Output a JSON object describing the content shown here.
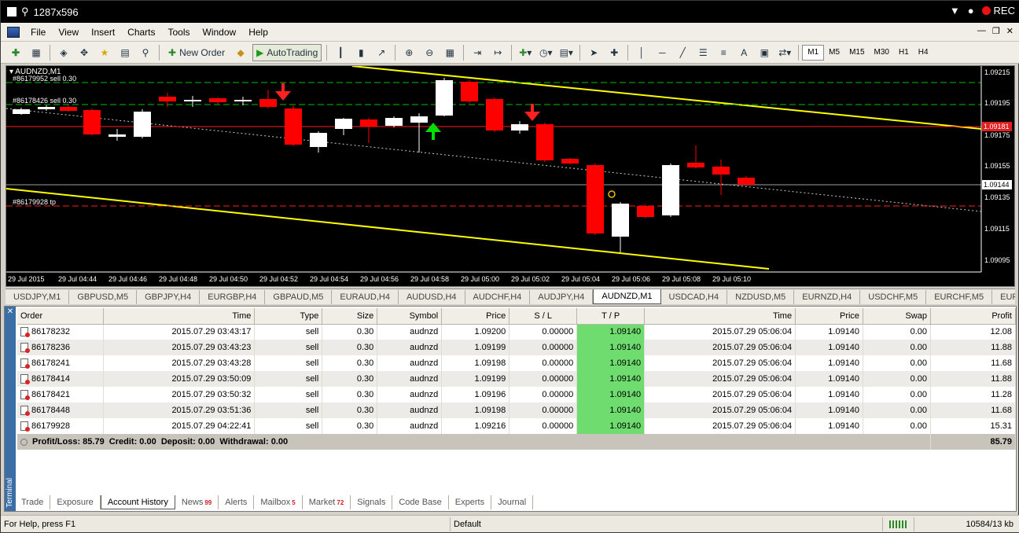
{
  "recorder": {
    "title": "1287x596",
    "rec_label": "REC"
  },
  "menu": [
    "File",
    "View",
    "Insert",
    "Charts",
    "Tools",
    "Window",
    "Help"
  ],
  "toolbar": {
    "new_order": "New Order",
    "autotrading": "AutoTrading",
    "timeframes": [
      "M1",
      "M5",
      "M15",
      "M30",
      "H1",
      "H4"
    ],
    "active_tf": "M1"
  },
  "chart": {
    "symbol_label": "AUDNZD,M1",
    "order_labels": [
      {
        "text": "#86179952 sell 0.30"
      },
      {
        "text": "#86178426 sell 0.30"
      },
      {
        "text": "#86179928 tp"
      }
    ],
    "price_labels": [
      "1.09215",
      "1.09195",
      "1.09175",
      "1.09155",
      "1.09135",
      "1.09115",
      "1.09095"
    ],
    "highlight_prices": {
      "bid": "1.09181",
      "tp": "1.09144"
    },
    "time_labels": [
      "29 Jul 2015",
      "29 Jul 04:44",
      "29 Jul 04:46",
      "29 Jul 04:48",
      "29 Jul 04:50",
      "29 Jul 04:52",
      "29 Jul 04:54",
      "29 Jul 04:56",
      "29 Jul 04:58",
      "29 Jul 05:00",
      "29 Jul 05:02",
      "29 Jul 05:04",
      "29 Jul 05:06",
      "29 Jul 05:08",
      "29 Jul 05:10"
    ]
  },
  "symbol_tabs": [
    "USDJPY,M1",
    "GBPUSD,M5",
    "GBPJPY,H4",
    "EURGBP,H4",
    "GBPAUD,M5",
    "EURAUD,H4",
    "AUDUSD,H4",
    "AUDCHF,H4",
    "AUDJPY,H4",
    "AUDNZD,M1",
    "USDCAD,H4",
    "NZDUSD,M5",
    "EURNZD,H4",
    "USDCHF,M5",
    "EURCHF,M5",
    "EURJPY,H"
  ],
  "active_symbol_tab": "AUDNZD,M1",
  "terminal": {
    "side_label": "Terminal",
    "columns": [
      "Order",
      "Time",
      "Type",
      "Size",
      "Symbol",
      "Price",
      "S / L",
      "T / P",
      "Time",
      "Price",
      "Swap",
      "Profit"
    ],
    "rows": [
      [
        "86178232",
        "2015.07.29 03:43:17",
        "sell",
        "0.30",
        "audnzd",
        "1.09200",
        "0.00000",
        "1.09140",
        "2015.07.29 05:06:04",
        "1.09140",
        "0.00",
        "12.08"
      ],
      [
        "86178236",
        "2015.07.29 03:43:23",
        "sell",
        "0.30",
        "audnzd",
        "1.09199",
        "0.00000",
        "1.09140",
        "2015.07.29 05:06:04",
        "1.09140",
        "0.00",
        "11.88"
      ],
      [
        "86178241",
        "2015.07.29 03:43:28",
        "sell",
        "0.30",
        "audnzd",
        "1.09198",
        "0.00000",
        "1.09140",
        "2015.07.29 05:06:04",
        "1.09140",
        "0.00",
        "11.68"
      ],
      [
        "86178414",
        "2015.07.29 03:50:09",
        "sell",
        "0.30",
        "audnzd",
        "1.09199",
        "0.00000",
        "1.09140",
        "2015.07.29 05:06:04",
        "1.09140",
        "0.00",
        "11.88"
      ],
      [
        "86178421",
        "2015.07.29 03:50:32",
        "sell",
        "0.30",
        "audnzd",
        "1.09196",
        "0.00000",
        "1.09140",
        "2015.07.29 05:06:04",
        "1.09140",
        "0.00",
        "11.28"
      ],
      [
        "86178448",
        "2015.07.29 03:51:36",
        "sell",
        "0.30",
        "audnzd",
        "1.09198",
        "0.00000",
        "1.09140",
        "2015.07.29 05:06:04",
        "1.09140",
        "0.00",
        "11.68"
      ],
      [
        "86179928",
        "2015.07.29 04:22:41",
        "sell",
        "0.30",
        "audnzd",
        "1.09216",
        "0.00000",
        "1.09140",
        "2015.07.29 05:06:04",
        "1.09140",
        "0.00",
        "15.31"
      ]
    ],
    "summary": "Profit/Loss: 85.79  Credit: 0.00  Deposit: 0.00  Withdrawal: 0.00",
    "summary_total": "85.79"
  },
  "bottom_tabs": [
    {
      "label": "Trade"
    },
    {
      "label": "Exposure"
    },
    {
      "label": "Account History",
      "active": true
    },
    {
      "label": "News",
      "badge": "99"
    },
    {
      "label": "Alerts"
    },
    {
      "label": "Mailbox",
      "badge": "5"
    },
    {
      "label": "Market",
      "badge": "72"
    },
    {
      "label": "Signals"
    },
    {
      "label": "Code Base"
    },
    {
      "label": "Experts"
    },
    {
      "label": "Journal"
    }
  ],
  "status": {
    "help": "For Help, press F1",
    "profile": "Default",
    "traffic": "10584/13 kb"
  },
  "colors": {
    "bull": "#ffffff",
    "bear": "#ff0000",
    "trend": "#ffff00",
    "tp_cell": "#6fdc6f",
    "sell_arrow": "#ff2020",
    "buy_arrow": "#00e000"
  }
}
